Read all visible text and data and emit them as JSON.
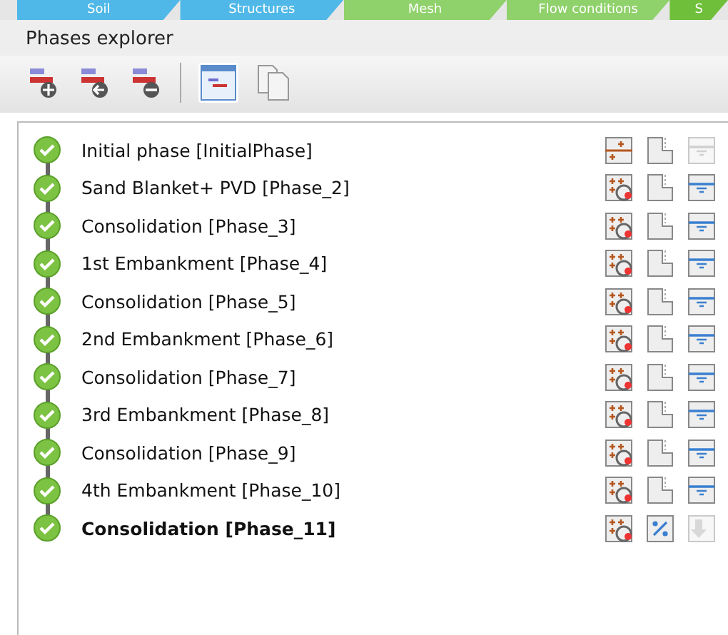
{
  "tabs": [
    {
      "label": "Soil",
      "color": "#4fb8e8"
    },
    {
      "label": "Structures",
      "color": "#4fb8e8"
    },
    {
      "label": "Mesh",
      "color": "#8fd16a"
    },
    {
      "label": "Flow conditions",
      "color": "#8fd16a"
    },
    {
      "label": "S",
      "color": "#6fbf3a"
    }
  ],
  "panel": {
    "title": "Phases explorer"
  },
  "toolbar": [
    {
      "kind": "add"
    },
    {
      "kind": "insert"
    },
    {
      "kind": "delete"
    },
    {
      "kind": "separator"
    },
    {
      "kind": "edit",
      "selected": true
    },
    {
      "kind": "copy",
      "selected": false
    }
  ],
  "phases": [
    {
      "label": "Initial phase [InitialPhase]",
      "selected": false,
      "icons": [
        {
          "kind": "initial",
          "disabled": false
        },
        {
          "kind": "staged",
          "disabled": false
        },
        {
          "kind": "water",
          "disabled": true
        }
      ]
    },
    {
      "label": "Sand Blanket+ PVD [Phase_2]",
      "selected": false,
      "icons": [
        {
          "kind": "consolidation",
          "disabled": false
        },
        {
          "kind": "staged",
          "disabled": false
        },
        {
          "kind": "water",
          "disabled": false
        }
      ]
    },
    {
      "label": "Consolidation [Phase_3]",
      "selected": false,
      "icons": [
        {
          "kind": "consolidation",
          "disabled": false
        },
        {
          "kind": "staged",
          "disabled": false
        },
        {
          "kind": "water",
          "disabled": false
        }
      ]
    },
    {
      "label": "1st Embankment [Phase_4]",
      "selected": false,
      "icons": [
        {
          "kind": "consolidation",
          "disabled": false
        },
        {
          "kind": "staged",
          "disabled": false
        },
        {
          "kind": "water",
          "disabled": false
        }
      ]
    },
    {
      "label": "Consolidation [Phase_5]",
      "selected": false,
      "icons": [
        {
          "kind": "consolidation",
          "disabled": false
        },
        {
          "kind": "staged",
          "disabled": false
        },
        {
          "kind": "water",
          "disabled": false
        }
      ]
    },
    {
      "label": "2nd Embankment [Phase_6]",
      "selected": false,
      "icons": [
        {
          "kind": "consolidation",
          "disabled": false
        },
        {
          "kind": "staged",
          "disabled": false
        },
        {
          "kind": "water",
          "disabled": false
        }
      ]
    },
    {
      "label": "Consolidation [Phase_7]",
      "selected": false,
      "icons": [
        {
          "kind": "consolidation",
          "disabled": false
        },
        {
          "kind": "staged",
          "disabled": false
        },
        {
          "kind": "water",
          "disabled": false
        }
      ]
    },
    {
      "label": "3rd Embankment [Phase_8]",
      "selected": false,
      "icons": [
        {
          "kind": "consolidation",
          "disabled": false
        },
        {
          "kind": "staged",
          "disabled": false
        },
        {
          "kind": "water",
          "disabled": false
        }
      ]
    },
    {
      "label": "Consolidation [Phase_9]",
      "selected": false,
      "icons": [
        {
          "kind": "consolidation",
          "disabled": false
        },
        {
          "kind": "staged",
          "disabled": false
        },
        {
          "kind": "water",
          "disabled": false
        }
      ]
    },
    {
      "label": "4th Embankment [Phase_10]",
      "selected": false,
      "icons": [
        {
          "kind": "consolidation",
          "disabled": false
        },
        {
          "kind": "staged",
          "disabled": false
        },
        {
          "kind": "water",
          "disabled": false
        }
      ]
    },
    {
      "label": "Consolidation [Phase_11]",
      "selected": true,
      "icons": [
        {
          "kind": "consolidation",
          "disabled": false
        },
        {
          "kind": "percent",
          "disabled": false
        },
        {
          "kind": "arrow",
          "disabled": true
        }
      ]
    }
  ]
}
